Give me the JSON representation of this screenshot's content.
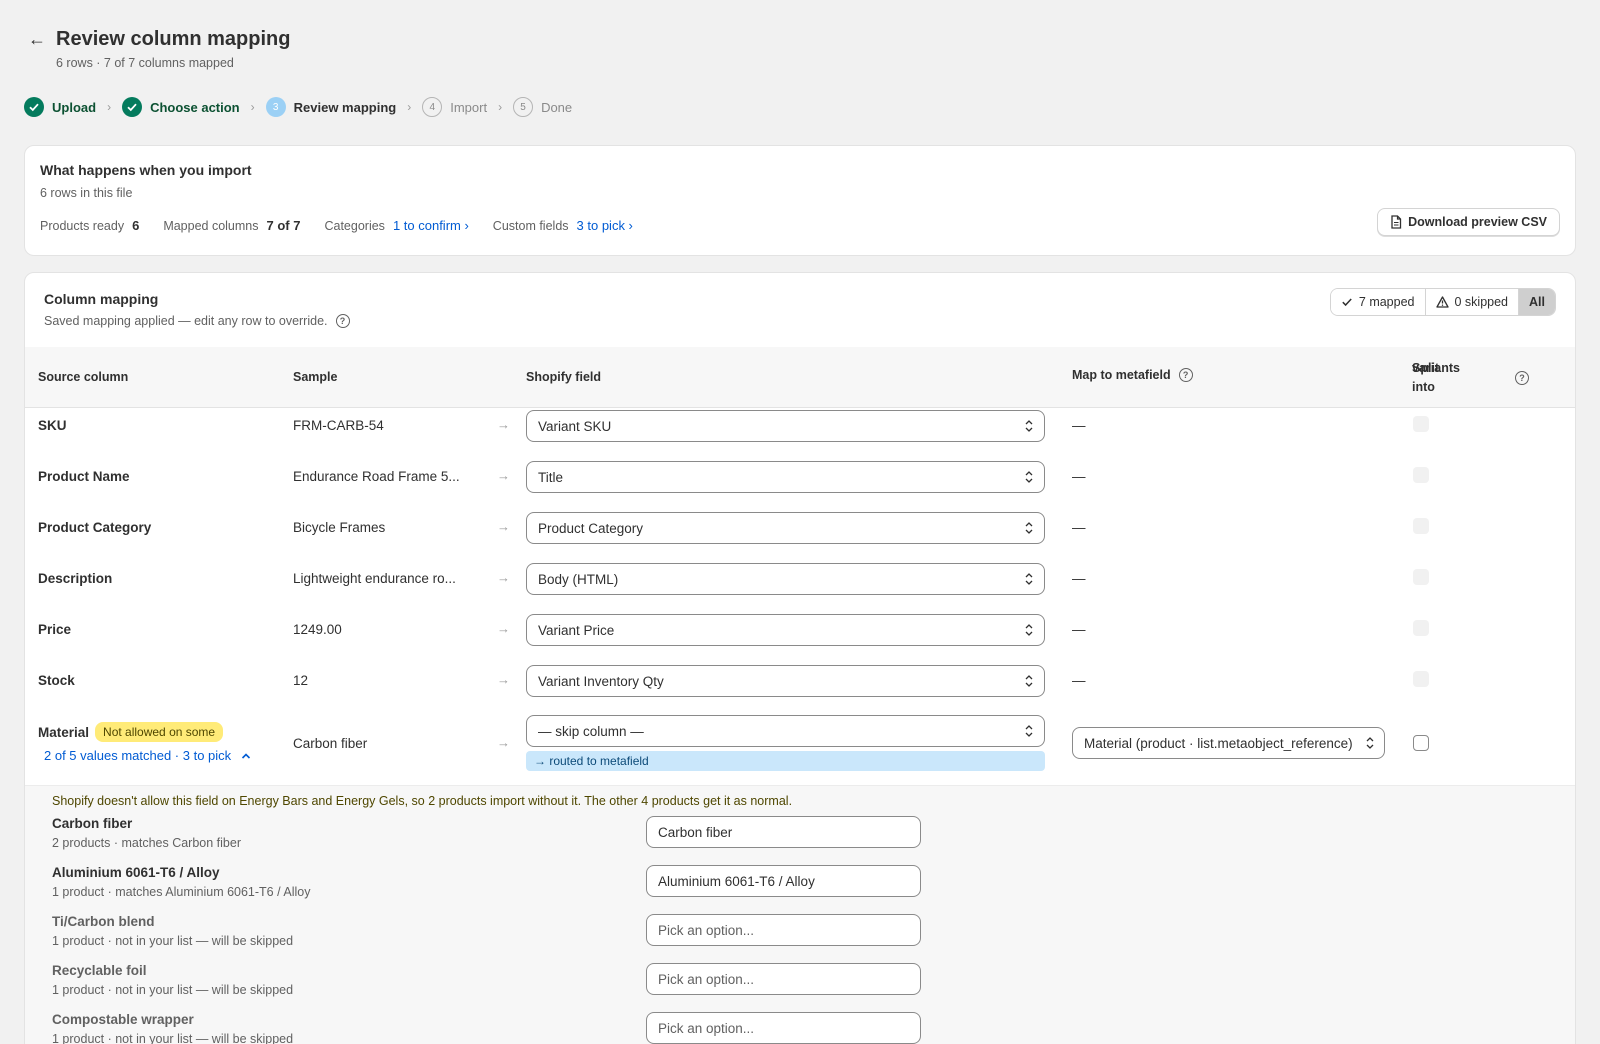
{
  "header": {
    "title": "Review column mapping",
    "subtitle": "6 rows · 7 of 7 columns mapped"
  },
  "steps": [
    {
      "label": "Upload",
      "state": "done"
    },
    {
      "label": "Choose action",
      "state": "done"
    },
    {
      "label": "Review mapping",
      "state": "current",
      "num": "3"
    },
    {
      "label": "Import",
      "state": "todo",
      "num": "4"
    },
    {
      "label": "Done",
      "state": "todo",
      "num": "5"
    }
  ],
  "summary": {
    "title": "What happens when you import",
    "subtitle": "6 rows in this file",
    "products_ready_label": "Products ready",
    "products_ready_value": "6",
    "mapped_columns_label": "Mapped columns",
    "mapped_columns_value": "7 of 7",
    "categories_label": "Categories",
    "categories_link": "1 to confirm ›",
    "custom_fields_label": "Custom fields",
    "custom_fields_link": "3 to pick ›",
    "download_label": "Download preview CSV"
  },
  "mapping": {
    "title": "Column mapping",
    "subtitle": "Saved mapping applied — edit any row to override.",
    "filter_mapped": "7 mapped",
    "filter_skipped": "0 skipped",
    "filter_all": "All",
    "columns": {
      "source": "Source column",
      "sample": "Sample",
      "shopify_field": "Shopify field",
      "metafield": "Map to metafield",
      "split_line1": "Split into",
      "split_line2": "variants"
    },
    "rows": [
      {
        "source": "SKU",
        "sample": "FRM-CARB-54",
        "field": "Variant SKU",
        "meta": "—"
      },
      {
        "source": "Product Name",
        "sample": "Endurance Road Frame 5...",
        "field": "Title",
        "meta": "—"
      },
      {
        "source": "Product Category",
        "sample": "Bicycle Frames",
        "field": "Product Category",
        "meta": "—"
      },
      {
        "source": "Description",
        "sample": "Lightweight endurance ro...",
        "field": "Body (HTML)",
        "meta": "—"
      },
      {
        "source": "Price",
        "sample": "1249.00",
        "field": "Variant Price",
        "meta": "—"
      },
      {
        "source": "Stock",
        "sample": "12",
        "field": "Variant Inventory Qty",
        "meta": "—"
      }
    ],
    "material": {
      "source": "Material",
      "badge": "Not allowed on some",
      "matched": "2 of 5 values matched · 3 to pick",
      "sample": "Carbon fiber",
      "field": "— skip column —",
      "routed": "→ routed to metafield",
      "metafield": "Material (product · list.metaobject_reference)",
      "warning": "Shopify doesn't allow this field on Energy Bars and Energy Gels, so 2 products import without it. The other 4 products get it as normal.",
      "values": [
        {
          "name": "Carbon fiber",
          "detail": "2 products · matches Carbon fiber",
          "input": "Carbon fiber",
          "skip": false
        },
        {
          "name": "Aluminium 6061-T6 / Alloy",
          "detail": "1 product · matches Aluminium 6061-T6 / Alloy",
          "input": "Aluminium 6061-T6 / Alloy",
          "skip": false
        },
        {
          "name": "Ti/Carbon blend",
          "detail": "1 product · not in your list — will be skipped",
          "input": "Pick an option...",
          "skip": true
        },
        {
          "name": "Recyclable foil",
          "detail": "1 product · not in your list — will be skipped",
          "input": "Pick an option...",
          "skip": true
        },
        {
          "name": "Compostable wrapper",
          "detail": "1 product · not in your list — will be skipped",
          "input": "Pick an option...",
          "skip": true
        }
      ]
    }
  }
}
